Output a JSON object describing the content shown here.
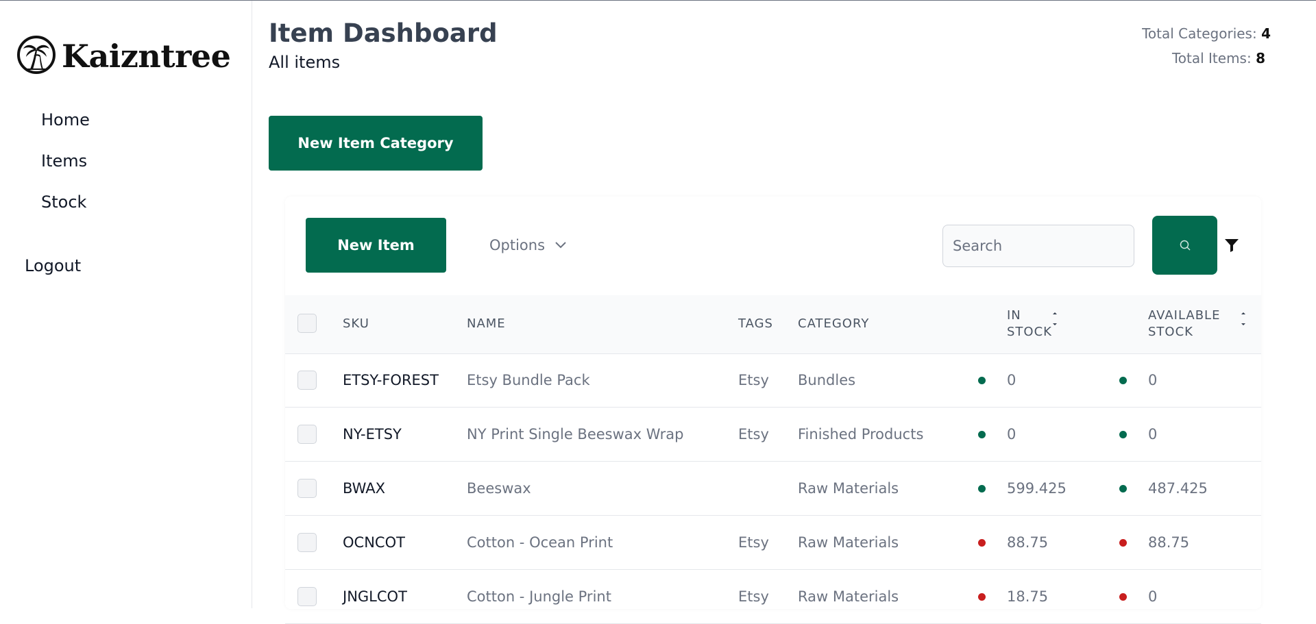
{
  "app": {
    "name": "Kaizntree"
  },
  "sidebar": {
    "items": [
      {
        "label": "Home"
      },
      {
        "label": "Items"
      },
      {
        "label": "Stock"
      }
    ],
    "logout_label": "Logout"
  },
  "header": {
    "title": "Item Dashboard",
    "subtitle": "All items",
    "total_categories_label": "Total Categories:",
    "total_categories_value": "4",
    "total_items_label": "Total Items:",
    "total_items_value": "8"
  },
  "actions": {
    "new_category_label": "New Item Category",
    "new_item_label": "New Item",
    "options_label": "Options",
    "search_placeholder": "Search",
    "search_value": ""
  },
  "table": {
    "headers": {
      "sku": "SKU",
      "name": "NAME",
      "tags": "TAGS",
      "category": "CATEGORY",
      "in_stock_1": "IN",
      "in_stock_2": "STOCK",
      "available_1": "AVAILABLE",
      "available_2": "STOCK"
    },
    "rows": [
      {
        "sku": "ETSY-FOREST",
        "name": "Etsy Bundle Pack",
        "tags": "Etsy",
        "category": "Bundles",
        "in_stock": "0",
        "available": "0",
        "in_status": "ok",
        "avail_status": "ok"
      },
      {
        "sku": "NY-ETSY",
        "name": "NY Print Single Beeswax Wrap",
        "tags": "Etsy",
        "category": "Finished Products",
        "in_stock": "0",
        "available": "0",
        "in_status": "ok",
        "avail_status": "ok"
      },
      {
        "sku": "BWAX",
        "name": "Beeswax",
        "tags": "",
        "category": "Raw Materials",
        "in_stock": "599.425",
        "available": "487.425",
        "in_status": "ok",
        "avail_status": "ok"
      },
      {
        "sku": "OCNCOT",
        "name": "Cotton - Ocean Print",
        "tags": "Etsy",
        "category": "Raw Materials",
        "in_stock": "88.75",
        "available": "88.75",
        "in_status": "low",
        "avail_status": "low"
      },
      {
        "sku": "JNGLCOT",
        "name": "Cotton - Jungle Print",
        "tags": "Etsy",
        "category": "Raw Materials",
        "in_stock": "18.75",
        "available": "0",
        "in_status": "low",
        "avail_status": "low"
      }
    ]
  },
  "colors": {
    "brand_green": "#036b4f",
    "status_ok": "#036b4f",
    "status_low": "#c81e1e"
  }
}
